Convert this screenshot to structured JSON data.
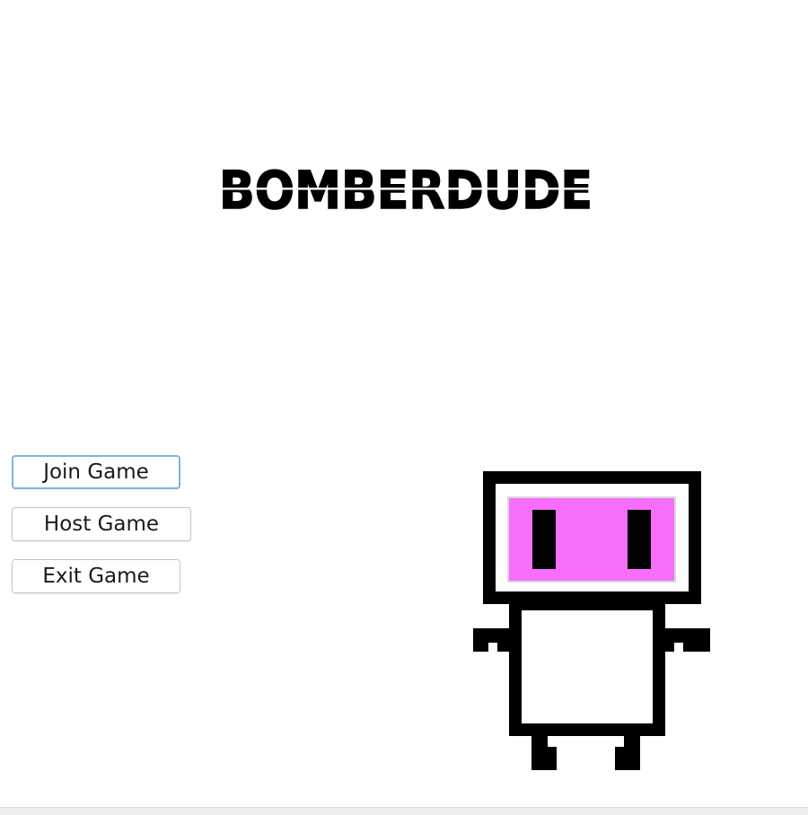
{
  "game": {
    "title": "BOMBERDUDE"
  },
  "menu": {
    "join_label": "Join Game",
    "host_label": "Host Game",
    "exit_label": "Exit Game"
  },
  "character": {
    "name": "bomberdude-character",
    "visor_color": "#f66ef9",
    "outline_color": "#000000",
    "body_color": "#ffffff"
  },
  "colors": {
    "background": "#ffffff",
    "focus_ring": "#7fb3e8"
  }
}
